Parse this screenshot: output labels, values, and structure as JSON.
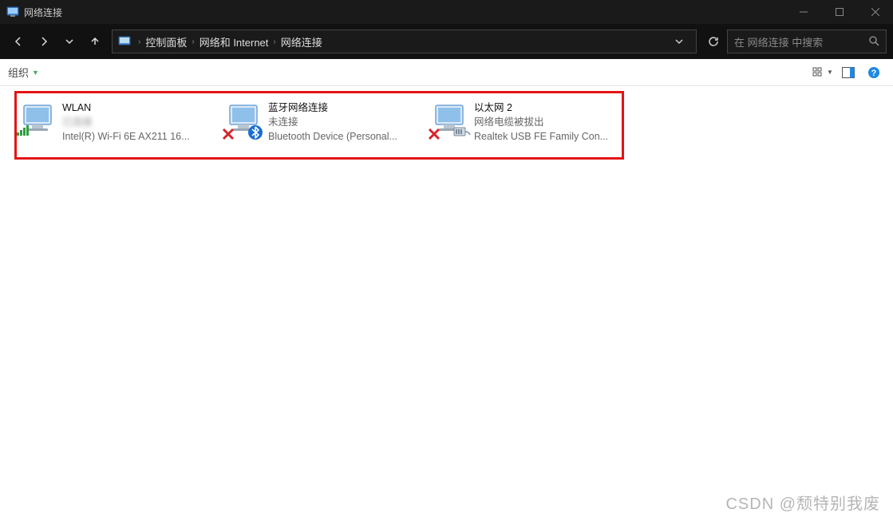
{
  "window": {
    "title": "网络连接",
    "minimize_tip": "Minimize",
    "maximize_tip": "Maximize",
    "close_tip": "Close"
  },
  "nav": {
    "back_tip": "Back",
    "forward_tip": "Forward",
    "recent_tip": "Recent",
    "up_tip": "Up",
    "dropdown_tip": "Previous locations",
    "refresh_tip": "Refresh"
  },
  "breadcrumb": {
    "items": [
      "控制面板",
      "网络和 Internet",
      "网络连接"
    ]
  },
  "search": {
    "placeholder": "在 网络连接 中搜索"
  },
  "cmdbar": {
    "organize": "组织",
    "view_tip": "View options",
    "preview_tip": "Preview pane",
    "help_tip": "Help"
  },
  "connections": [
    {
      "name": "WLAN",
      "status_blurred": true,
      "status": "已连接",
      "device": "Intel(R) Wi-Fi 6E AX211 16...",
      "icon": "wifi",
      "disconnected": false
    },
    {
      "name": "蓝牙网络连接",
      "status_blurred": false,
      "status": "未连接",
      "device": "Bluetooth Device (Personal...",
      "icon": "bluetooth",
      "disconnected": true
    },
    {
      "name": "以太网 2",
      "status_blurred": false,
      "status": "网络电缆被拔出",
      "device": "Realtek USB FE Family Con...",
      "icon": "ethernet",
      "disconnected": true
    }
  ],
  "watermark": "CSDN @颓特别我废"
}
